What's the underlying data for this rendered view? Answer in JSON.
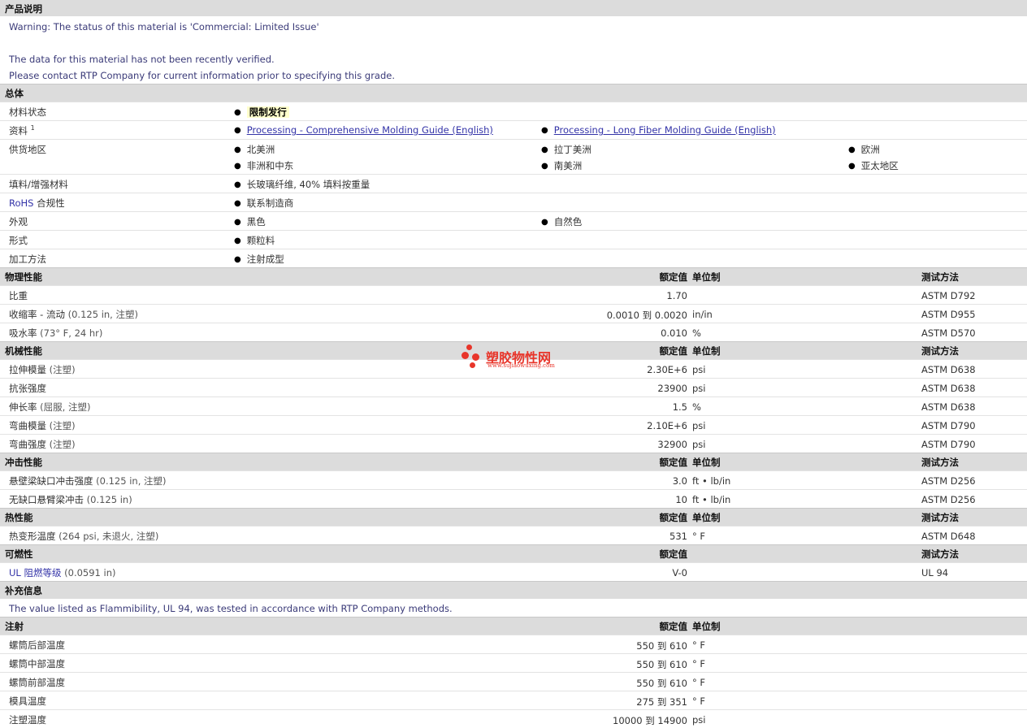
{
  "product": {
    "title": "产品说明",
    "warning": "Warning: The status of this material is 'Commercial: Limited Issue'",
    "note1": "The data for this material has not been recently verified.",
    "note2": "Please contact RTP Company for current information prior to specifying this grade."
  },
  "general": {
    "title": "总体",
    "status_label": "材料状态",
    "status_value": "限制发行",
    "docs_label": "资料",
    "docs_sup": "1",
    "doc1": "Processing - Comprehensive Molding Guide (English)",
    "doc2": "Processing - Long Fiber Molding Guide (English)",
    "region_label": "供货地区",
    "regions": [
      "北美洲",
      "拉丁美洲",
      "欧洲",
      "非洲和中东",
      "南美洲",
      "亚太地区"
    ],
    "filler_label": "填料/增强材料",
    "filler_value": "长玻璃纤维, 40% 填料按重量",
    "rohs_label_a": "RoHS",
    "rohs_label_b": " 合规性",
    "rohs_value": "联系制造商",
    "appearance_label": "外观",
    "appearance": [
      "黑色",
      "自然色"
    ],
    "form_label": "形式",
    "form_value": "颗粒料",
    "process_label": "加工方法",
    "process_value": "注射成型"
  },
  "headers": {
    "value": "额定值",
    "unit": "单位制",
    "test": "测试方法"
  },
  "physical": {
    "title": "物理性能",
    "rows": [
      {
        "label": "比重",
        "cond": "",
        "value": "1.70",
        "unit": "",
        "test": "ASTM D792"
      },
      {
        "label": "收缩率 - 流动",
        "cond": " (0.125 in, 注塑)",
        "value": "0.0010 到  0.0020",
        "unit": "in/in",
        "test": "ASTM D955"
      },
      {
        "label": "吸水率",
        "cond": " (73°  F, 24 hr)",
        "value": "0.010",
        "unit": "%",
        "test": "ASTM D570"
      }
    ]
  },
  "mechanical": {
    "title": "机械性能",
    "rows": [
      {
        "label": "拉伸模量",
        "cond": " (注塑)",
        "value": "2.30E+6",
        "unit": "psi",
        "test": "ASTM D638"
      },
      {
        "label": "抗张强度",
        "cond": "",
        "value": "23900",
        "unit": "psi",
        "test": "ASTM D638"
      },
      {
        "label": "伸长率",
        "cond": " (屈服, 注塑)",
        "value": "1.5",
        "unit": "%",
        "test": "ASTM D638"
      },
      {
        "label": "弯曲模量",
        "cond": " (注塑)",
        "value": "2.10E+6",
        "unit": "psi",
        "test": "ASTM D790"
      },
      {
        "label": "弯曲强度",
        "cond": " (注塑)",
        "value": "32900",
        "unit": "psi",
        "test": "ASTM D790"
      }
    ]
  },
  "impact": {
    "title": "冲击性能",
    "rows": [
      {
        "label": "悬壁梁缺口冲击强度",
        "cond": " (0.125 in, 注塑)",
        "value": "3.0",
        "unit": "ft • lb/in",
        "test": "ASTM D256"
      },
      {
        "label": "无缺口悬臂梁冲击",
        "cond": " (0.125 in)",
        "value": "10",
        "unit": "ft • lb/in",
        "test": "ASTM D256"
      }
    ]
  },
  "thermal": {
    "title": "热性能",
    "rows": [
      {
        "label": "热变形温度",
        "cond": " (264 psi, 未退火, 注塑)",
        "value": "531",
        "unit": "°  F",
        "test": "ASTM D648"
      }
    ]
  },
  "flammability": {
    "title": "可燃性",
    "rows": [
      {
        "label": "UL 阻燃等级",
        "cond": " (0.0591 in)",
        "value": "V-0",
        "unit": "",
        "test": "UL 94"
      }
    ]
  },
  "supplement": {
    "title": "补充信息",
    "text": "The value listed as Flammibility, UL 94, was tested in accordance with RTP Company methods."
  },
  "injection": {
    "title": "注射",
    "rows": [
      {
        "label": "螺筒后部温度",
        "value": "550 到  610",
        "unit": "°  F"
      },
      {
        "label": "螺筒中部温度",
        "value": "550 到  610",
        "unit": "°  F"
      },
      {
        "label": "螺筒前部温度",
        "value": "550 到  610",
        "unit": "°  F"
      },
      {
        "label": "模具温度",
        "value": "275 到  351",
        "unit": "°  F"
      },
      {
        "label": "注塑温度",
        "value": "10000 到  14900",
        "unit": "psi"
      }
    ]
  },
  "watermark": {
    "cn": "塑胶物性网",
    "url": "www.sujiaowuxing.com",
    "color": "#e8352a"
  }
}
